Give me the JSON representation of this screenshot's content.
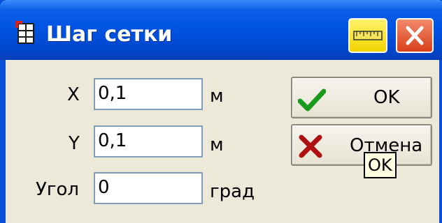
{
  "window": {
    "title": "Шаг сетки",
    "icons": {
      "app": "grid-app-icon",
      "ruler": "ruler-icon",
      "close": "close-icon"
    }
  },
  "form": {
    "x": {
      "label": "X",
      "value": "0,1",
      "unit": "м"
    },
    "y": {
      "label": "Y",
      "value": "0,1",
      "unit": "м"
    },
    "angle": {
      "label": "Угол",
      "value": "0",
      "unit": "град"
    }
  },
  "buttons": {
    "ok": {
      "label": "OK",
      "icon": "checkmark-icon"
    },
    "cancel": {
      "label": "Отмена",
      "icon": "cross-icon"
    }
  },
  "tooltip": {
    "text": "OK"
  },
  "colors": {
    "titlebar": "#0054e3",
    "check": "#1a9a1a",
    "cross": "#b01010",
    "ruler_button": "#f2d500",
    "close_button": "#d8401a"
  }
}
